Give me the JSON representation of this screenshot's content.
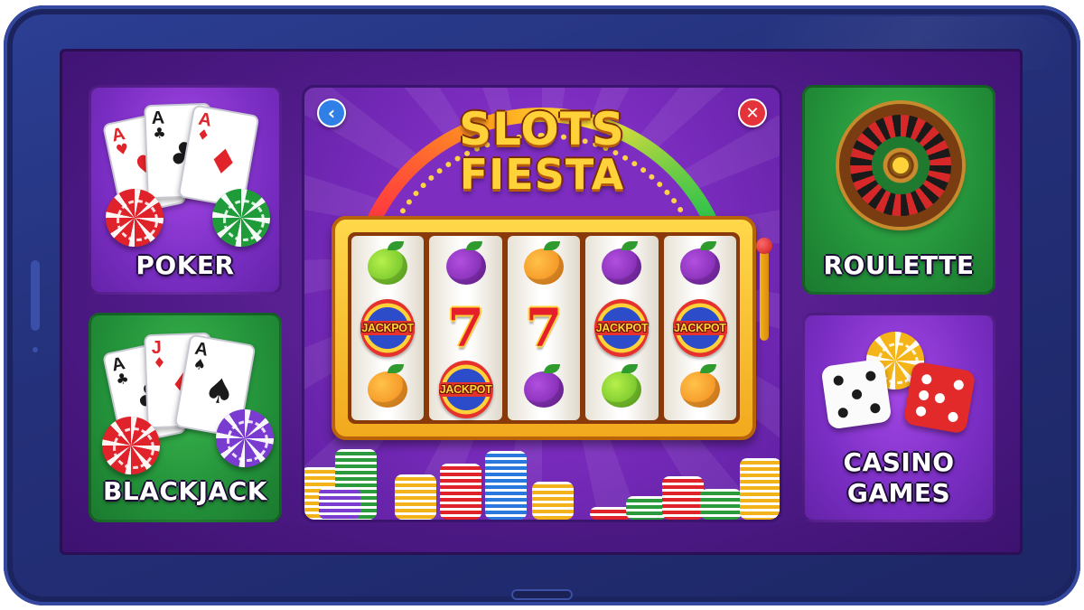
{
  "games": {
    "poker": {
      "label": "POKER"
    },
    "blackjack": {
      "label": "BLACKJACK"
    },
    "roulette": {
      "label": "ROULETTE"
    },
    "casino": {
      "label_line1": "CASINO",
      "label_line2": "GAMES"
    }
  },
  "slots": {
    "title_line1": "SLOTS",
    "title_line2": "FIESTA",
    "back_icon": "chevron-left-icon",
    "close_icon": "close-icon",
    "jackpot_text": "JACKPOT",
    "seven_text": "7",
    "reels": [
      [
        "lime",
        "jackpot",
        "orange"
      ],
      [
        "plum",
        "seven",
        "jackpot"
      ],
      [
        "orange",
        "seven",
        "plum"
      ],
      [
        "plum",
        "jackpot",
        "lime"
      ],
      [
        "plum",
        "jackpot",
        "orange"
      ]
    ]
  },
  "cards": {
    "poker": [
      {
        "rank": "A",
        "suit": "♥"
      },
      {
        "rank": "A",
        "suit": "♣"
      },
      {
        "rank": "A",
        "suit": "♦"
      }
    ],
    "blackjack": [
      {
        "rank": "A",
        "suit": "♣"
      },
      {
        "rank": "J",
        "suit": "♦"
      },
      {
        "rank": "A",
        "suit": "♠"
      }
    ]
  },
  "colors": {
    "frame": "#24307a",
    "screen": "#4e1a86",
    "tile_purple": "#7b2ec4",
    "tile_green": "#23913a",
    "title_gold": "#ffd23a"
  }
}
